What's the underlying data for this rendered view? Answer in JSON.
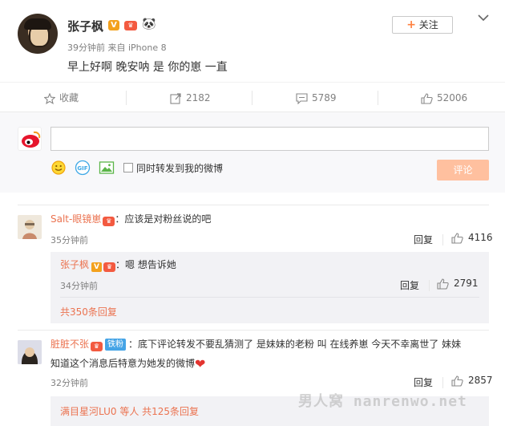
{
  "post": {
    "author": "张子枫",
    "meta": "39分钟前 来自 iPhone 8",
    "text": "早上好啊 晚安呐 是 你的崽 一直",
    "follow_label": "关注",
    "follow_plus": "+"
  },
  "actions": {
    "favorite_label": "收藏",
    "repost_count": "2182",
    "comment_count": "5789",
    "like_count": "52006"
  },
  "composer": {
    "input_value": "",
    "repost_option_label": "同时转发到我的微博",
    "submit_label": "评论"
  },
  "comments": [
    {
      "username": "Salt-眼镜崽",
      "text": "：应该是对粉丝说的吧",
      "time": "35分钟前",
      "reply_label": "回复",
      "likes": "4116",
      "sub": {
        "username": "张子枫",
        "text": "：嗯 想告诉她",
        "time": "34分钟前",
        "reply_label": "回复",
        "likes": "2791",
        "more_label": "共350条回复"
      }
    },
    {
      "username": "脏脏不张",
      "tag": "铁粉",
      "text_line1": "：底下评论转发不要乱猜测了 是妹妹的老粉 叫 在线养崽 今天不幸离世了 妹妹",
      "text_line2": "知道这个消息后特意为她发的微博",
      "time": "32分钟前",
      "reply_label": "回复",
      "likes": "2857",
      "sub": {
        "more_prefix": "满目星河LU0 等人",
        "more_label": "共125条回复"
      }
    }
  ],
  "badges": {
    "v": "V",
    "crown": "♛"
  },
  "watermark": "男人窝 nanrenwo.net",
  "colors": {
    "accent": "#eb7350",
    "submit_bg": "#ffc09f",
    "link": "#eb7350",
    "fans_tag": "#45a4e6"
  }
}
